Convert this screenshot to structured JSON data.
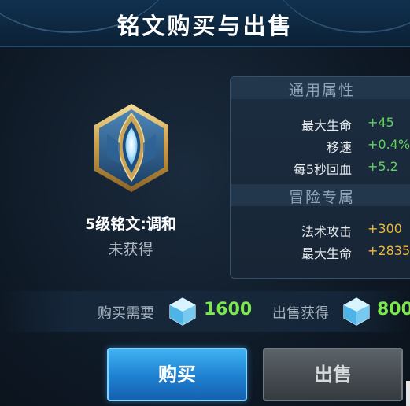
{
  "dialog": {
    "title": "铭文购买与出售"
  },
  "rune": {
    "name": "5级铭文:调和",
    "status": "未获得",
    "icon": "teardrop-rune-icon"
  },
  "stats": {
    "general": {
      "title": "通用属性",
      "rows": [
        {
          "label": "最大生命",
          "value": "+45"
        },
        {
          "label": "移速",
          "value": "+0.4%"
        },
        {
          "label": "每5秒回血",
          "value": "+5.2"
        }
      ]
    },
    "adventure": {
      "title": "冒险专属",
      "rows": [
        {
          "label": "法术攻击",
          "value": "+300"
        },
        {
          "label": "最大生命",
          "value": "+2835"
        }
      ]
    }
  },
  "price": {
    "buy_label": "购买需要",
    "buy_value": "1600",
    "sell_label": "出售获得",
    "sell_value": "800",
    "currency_icon": "crystal-gem-icon"
  },
  "buttons": {
    "buy": "购买",
    "sell": "出售"
  },
  "colors": {
    "bonus_green": "#5ed35c",
    "bonus_yellow": "#f0b63c",
    "price_green": "#7de84e",
    "buy_blue": "#1e7fd0",
    "sell_gray": "#454b50"
  }
}
